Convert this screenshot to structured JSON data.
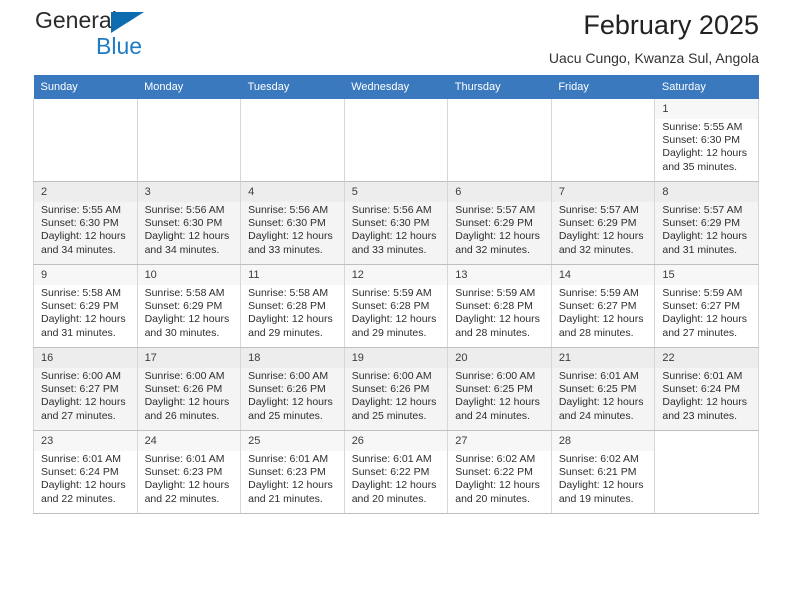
{
  "brand": {
    "name_part1": "General",
    "name_part2": "Blue",
    "triangle_color": "#0d6bb0",
    "blue_text_color": "#1f7cc4"
  },
  "header": {
    "title": "February 2025",
    "subtitle": "Uacu Cungo, Kwanza Sul, Angola"
  },
  "calendar": {
    "header_bg": "#3b79be",
    "weekday_headers": [
      "Sunday",
      "Monday",
      "Tuesday",
      "Wednesday",
      "Thursday",
      "Friday",
      "Saturday"
    ],
    "labels": {
      "sunrise": "Sunrise:",
      "sunset": "Sunset:",
      "daylight": "Daylight:"
    },
    "weeks": [
      {
        "shaded": false,
        "days": [
          {
            "empty": true
          },
          {
            "empty": true
          },
          {
            "empty": true
          },
          {
            "empty": true
          },
          {
            "empty": true
          },
          {
            "empty": true
          },
          {
            "day": "1",
            "sunrise": "Sunrise: 5:55 AM",
            "sunset": "Sunset: 6:30 PM",
            "daylight": "Daylight: 12 hours and 35 minutes."
          }
        ]
      },
      {
        "shaded": true,
        "days": [
          {
            "day": "2",
            "sunrise": "Sunrise: 5:55 AM",
            "sunset": "Sunset: 6:30 PM",
            "daylight": "Daylight: 12 hours and 34 minutes."
          },
          {
            "day": "3",
            "sunrise": "Sunrise: 5:56 AM",
            "sunset": "Sunset: 6:30 PM",
            "daylight": "Daylight: 12 hours and 34 minutes."
          },
          {
            "day": "4",
            "sunrise": "Sunrise: 5:56 AM",
            "sunset": "Sunset: 6:30 PM",
            "daylight": "Daylight: 12 hours and 33 minutes."
          },
          {
            "day": "5",
            "sunrise": "Sunrise: 5:56 AM",
            "sunset": "Sunset: 6:30 PM",
            "daylight": "Daylight: 12 hours and 33 minutes."
          },
          {
            "day": "6",
            "sunrise": "Sunrise: 5:57 AM",
            "sunset": "Sunset: 6:29 PM",
            "daylight": "Daylight: 12 hours and 32 minutes."
          },
          {
            "day": "7",
            "sunrise": "Sunrise: 5:57 AM",
            "sunset": "Sunset: 6:29 PM",
            "daylight": "Daylight: 12 hours and 32 minutes."
          },
          {
            "day": "8",
            "sunrise": "Sunrise: 5:57 AM",
            "sunset": "Sunset: 6:29 PM",
            "daylight": "Daylight: 12 hours and 31 minutes."
          }
        ]
      },
      {
        "shaded": false,
        "days": [
          {
            "day": "9",
            "sunrise": "Sunrise: 5:58 AM",
            "sunset": "Sunset: 6:29 PM",
            "daylight": "Daylight: 12 hours and 31 minutes."
          },
          {
            "day": "10",
            "sunrise": "Sunrise: 5:58 AM",
            "sunset": "Sunset: 6:29 PM",
            "daylight": "Daylight: 12 hours and 30 minutes."
          },
          {
            "day": "11",
            "sunrise": "Sunrise: 5:58 AM",
            "sunset": "Sunset: 6:28 PM",
            "daylight": "Daylight: 12 hours and 29 minutes."
          },
          {
            "day": "12",
            "sunrise": "Sunrise: 5:59 AM",
            "sunset": "Sunset: 6:28 PM",
            "daylight": "Daylight: 12 hours and 29 minutes."
          },
          {
            "day": "13",
            "sunrise": "Sunrise: 5:59 AM",
            "sunset": "Sunset: 6:28 PM",
            "daylight": "Daylight: 12 hours and 28 minutes."
          },
          {
            "day": "14",
            "sunrise": "Sunrise: 5:59 AM",
            "sunset": "Sunset: 6:27 PM",
            "daylight": "Daylight: 12 hours and 28 minutes."
          },
          {
            "day": "15",
            "sunrise": "Sunrise: 5:59 AM",
            "sunset": "Sunset: 6:27 PM",
            "daylight": "Daylight: 12 hours and 27 minutes."
          }
        ]
      },
      {
        "shaded": true,
        "days": [
          {
            "day": "16",
            "sunrise": "Sunrise: 6:00 AM",
            "sunset": "Sunset: 6:27 PM",
            "daylight": "Daylight: 12 hours and 27 minutes."
          },
          {
            "day": "17",
            "sunrise": "Sunrise: 6:00 AM",
            "sunset": "Sunset: 6:26 PM",
            "daylight": "Daylight: 12 hours and 26 minutes."
          },
          {
            "day": "18",
            "sunrise": "Sunrise: 6:00 AM",
            "sunset": "Sunset: 6:26 PM",
            "daylight": "Daylight: 12 hours and 25 minutes."
          },
          {
            "day": "19",
            "sunrise": "Sunrise: 6:00 AM",
            "sunset": "Sunset: 6:26 PM",
            "daylight": "Daylight: 12 hours and 25 minutes."
          },
          {
            "day": "20",
            "sunrise": "Sunrise: 6:00 AM",
            "sunset": "Sunset: 6:25 PM",
            "daylight": "Daylight: 12 hours and 24 minutes."
          },
          {
            "day": "21",
            "sunrise": "Sunrise: 6:01 AM",
            "sunset": "Sunset: 6:25 PM",
            "daylight": "Daylight: 12 hours and 24 minutes."
          },
          {
            "day": "22",
            "sunrise": "Sunrise: 6:01 AM",
            "sunset": "Sunset: 6:24 PM",
            "daylight": "Daylight: 12 hours and 23 minutes."
          }
        ]
      },
      {
        "shaded": false,
        "days": [
          {
            "day": "23",
            "sunrise": "Sunrise: 6:01 AM",
            "sunset": "Sunset: 6:24 PM",
            "daylight": "Daylight: 12 hours and 22 minutes."
          },
          {
            "day": "24",
            "sunrise": "Sunrise: 6:01 AM",
            "sunset": "Sunset: 6:23 PM",
            "daylight": "Daylight: 12 hours and 22 minutes."
          },
          {
            "day": "25",
            "sunrise": "Sunrise: 6:01 AM",
            "sunset": "Sunset: 6:23 PM",
            "daylight": "Daylight: 12 hours and 21 minutes."
          },
          {
            "day": "26",
            "sunrise": "Sunrise: 6:01 AM",
            "sunset": "Sunset: 6:22 PM",
            "daylight": "Daylight: 12 hours and 20 minutes."
          },
          {
            "day": "27",
            "sunrise": "Sunrise: 6:02 AM",
            "sunset": "Sunset: 6:22 PM",
            "daylight": "Daylight: 12 hours and 20 minutes."
          },
          {
            "day": "28",
            "sunrise": "Sunrise: 6:02 AM",
            "sunset": "Sunset: 6:21 PM",
            "daylight": "Daylight: 12 hours and 19 minutes."
          },
          {
            "empty": true
          }
        ]
      }
    ]
  }
}
